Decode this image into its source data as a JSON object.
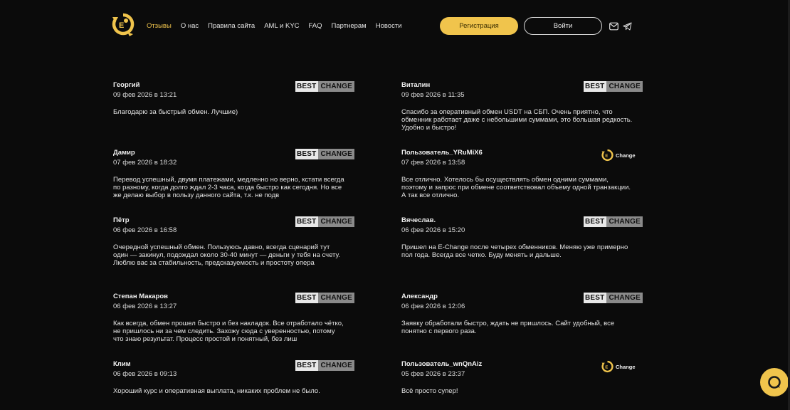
{
  "nav": {
    "items": [
      {
        "label": "Отзывы",
        "active": true
      },
      {
        "label": "О нас"
      },
      {
        "label": "Правила сайта"
      },
      {
        "label": "AML и KYC"
      },
      {
        "label": "FAQ"
      },
      {
        "label": "Партнерам"
      },
      {
        "label": "Новости"
      }
    ]
  },
  "header": {
    "register_label": "Регистрация",
    "login_label": "Войти",
    "icons": [
      "mail-icon",
      "telegram-icon"
    ]
  },
  "colors": {
    "accent": "#f0c44c",
    "background": "#0b0b0b"
  },
  "reviews": [
    {
      "name": "Георгий",
      "date": "09 фев 2026 в 13:21",
      "source": "bestchange",
      "text": "Благодарю за быстрый обмен. Лучшие)"
    },
    {
      "name": "Виталин",
      "date": "09 фев 2026 в 11:35",
      "source": "bestchange",
      "text": "Спасибо за оперативный обмен USDT на СБП. Очень приятно, что обменник работает даже с небольшими суммами, это большая редкость. Удобно и быстро!"
    },
    {
      "name": "Дамир",
      "date": "07 фев 2026 в 18:32",
      "source": "bestchange",
      "text": "Перевод успешный, двумя платежами, медленно но верно, кстати всегда по разному, когда долго ждал 2-3 часа, когда быстро как сегодня. Но все же делаю выбор в пользу данного сайта, т.к. не подв"
    },
    {
      "name": "Пользователь_YRuMiX6",
      "date": "07 фев 2026 в 13:58",
      "source": "echange",
      "text": "Все отлично. Хотелось бы осуществлять обмен одними суммами, поэтому и запрос при обмене соответствовал объему одной транзакции. А так все отлично."
    },
    {
      "name": "Пётр",
      "date": "06 фев 2026 в 16:58",
      "source": "bestchange",
      "text": "Очередной успешный обмен. Пользуюсь давно, всегда сценарий тут один — закинул, подождал около 30-40 минут — деньги у тебя на счету. Люблю вас за стабильность, предсказуемость и простоту опера"
    },
    {
      "name": "Вячеслав.",
      "date": "06 фев 2026 в 15:20",
      "source": "bestchange",
      "text": "Пришел на E-Change после четырех обменников. Меняю уже примерно пол года. Всегда все четко. Буду менять и дальше."
    },
    {
      "name": "Степан Макаров",
      "date": "06 фев 2026 в 13:27",
      "source": "bestchange",
      "text": "Как всегда, обмен прошел быстро и без накладок. Все отработало чётко, не пришлось ни за чем следить. Захожу сюда с уверенностью, потому что знаю результат. Процесс простой и понятный, без лиш"
    },
    {
      "name": "Александр",
      "date": "06 фев 2026 в 12:06",
      "source": "bestchange",
      "text": "Заявку обработали быстро, ждать не пришлось. Сайт удобный, все понятно с первого раза."
    },
    {
      "name": "Клим",
      "date": "06 фев 2026 в 09:13",
      "source": "bestchange",
      "text": "Хороший курс и оперативная выплата, никаких проблем не было."
    },
    {
      "name": "Пользователь_wnQnAiz",
      "date": "05 фев 2026 в 23:37",
      "source": "echange",
      "text": "Всё просто супер!"
    }
  ],
  "badges": {
    "bestchange_part1": "BEST",
    "bestchange_part2": "CHANGE",
    "echange_label": "Change"
  },
  "chat_widget": {
    "icon": "chat-bubble-icon"
  }
}
